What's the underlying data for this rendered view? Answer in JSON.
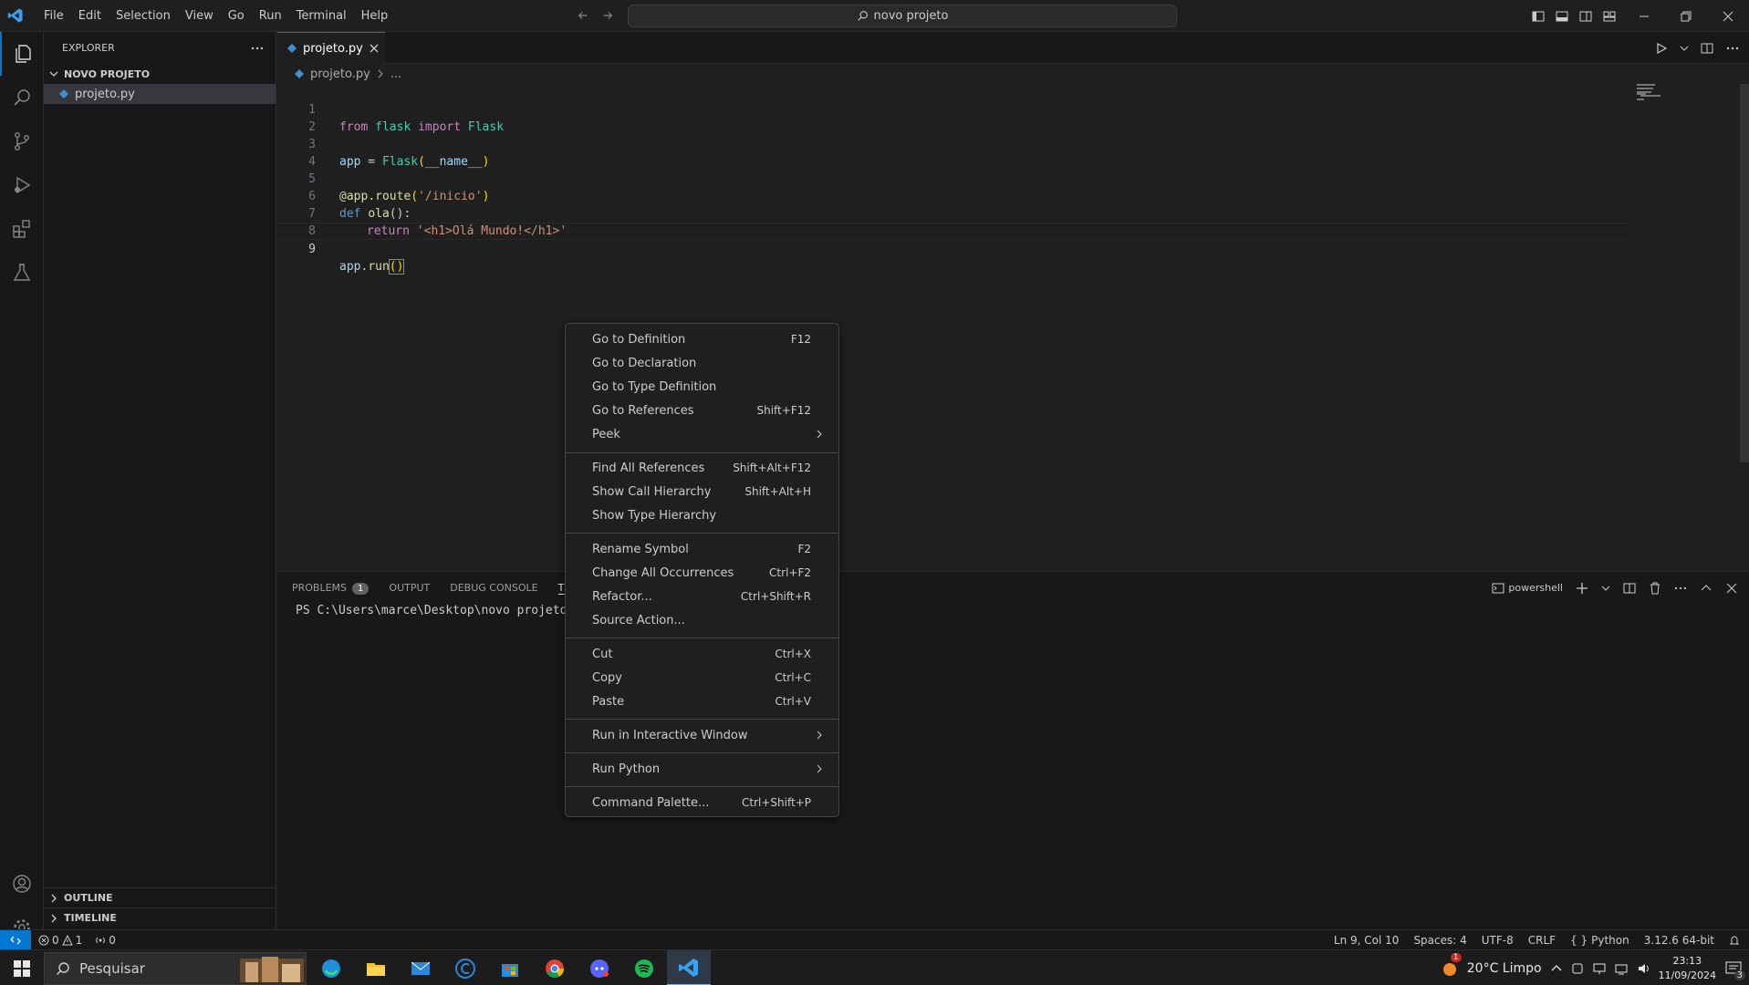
{
  "title_bar": {
    "menus": [
      "File",
      "Edit",
      "Selection",
      "View",
      "Go",
      "Run",
      "Terminal",
      "Help"
    ],
    "search_text": "novo projeto"
  },
  "sidebar": {
    "header": "EXPLORER",
    "folder": "NOVO PROJETO",
    "files": [
      "projeto.py"
    ],
    "outline": "OUTLINE",
    "timeline": "TIMELINE"
  },
  "editor": {
    "tab_label": "projeto.py",
    "breadcrumb_file": "projeto.py",
    "breadcrumb_rest": "...",
    "line_numbers": [
      "1",
      "2",
      "3",
      "4",
      "5",
      "6",
      "7",
      "8",
      "9"
    ],
    "code": {
      "l1_from": "from",
      "l1_mod": "flask",
      "l1_import": "import",
      "l1_cls": "Flask",
      "l3_var": "app",
      "l3_eq": " = ",
      "l3_cls": "Flask",
      "l3_p1": "(",
      "l3_arg": "__name__",
      "l3_p2": ")",
      "l5_at": "@",
      "l5_obj": "app",
      "l5_dot": ".",
      "l5_fn": "route",
      "l5_p1": "(",
      "l5_str": "'/inicio'",
      "l5_p2": ")",
      "l6_def": "def",
      "l6_fn": "ola",
      "l6_rest": "():",
      "l7_ret": "return",
      "l7_str": "'<h1>Olá Mundo!</h1>'",
      "l9_obj": "app",
      "l9_dot": ".",
      "l9_fn": "run",
      "l9_parens": "()"
    }
  },
  "panel": {
    "tabs": [
      "PROBLEMS",
      "OUTPUT",
      "DEBUG CONSOLE",
      "TER"
    ],
    "problems_count": "1",
    "terminal_name": "powershell",
    "prompt": "PS C:\\Users\\marce\\Desktop\\novo projeto>"
  },
  "context_menu": {
    "groups": [
      [
        {
          "label": "Go to Definition",
          "shortcut": "F12"
        },
        {
          "label": "Go to Declaration",
          "shortcut": ""
        },
        {
          "label": "Go to Type Definition",
          "shortcut": ""
        },
        {
          "label": "Go to References",
          "shortcut": "Shift+F12"
        },
        {
          "label": "Peek",
          "shortcut": ""
        }
      ],
      [
        {
          "label": "Find All References",
          "shortcut": "Shift+Alt+F12"
        },
        {
          "label": "Show Call Hierarchy",
          "shortcut": "Shift+Alt+H"
        },
        {
          "label": "Show Type Hierarchy",
          "shortcut": ""
        }
      ],
      [
        {
          "label": "Rename Symbol",
          "shortcut": "F2"
        },
        {
          "label": "Change All Occurrences",
          "shortcut": "Ctrl+F2"
        },
        {
          "label": "Refactor...",
          "shortcut": "Ctrl+Shift+R"
        },
        {
          "label": "Source Action...",
          "shortcut": ""
        }
      ],
      [
        {
          "label": "Cut",
          "shortcut": "Ctrl+X"
        },
        {
          "label": "Copy",
          "shortcut": "Ctrl+C"
        },
        {
          "label": "Paste",
          "shortcut": "Ctrl+V"
        }
      ],
      [
        {
          "label": "Run in Interactive Window",
          "shortcut": ""
        }
      ],
      [
        {
          "label": "Run Python",
          "shortcut": ""
        }
      ],
      [
        {
          "label": "Command Palette...",
          "shortcut": "Ctrl+Shift+P"
        }
      ]
    ]
  },
  "status_bar": {
    "errors": "0",
    "warnings": "1",
    "ports": "0",
    "cursor_pos": "Ln 9, Col 10",
    "spaces": "Spaces: 4",
    "encoding": "UTF-8",
    "eol": "CRLF",
    "language": "Python",
    "interpreter": "3.12.6 64-bit"
  },
  "taskbar": {
    "search_placeholder": "Pesquisar",
    "weather": "20°C  Limpo",
    "weather_badge": "1",
    "time": "23:13",
    "date": "11/09/2024",
    "notifications": "3"
  },
  "colors": {
    "accent": "#0078d4",
    "background": "#1f1f1f",
    "sidebar": "#181818"
  }
}
